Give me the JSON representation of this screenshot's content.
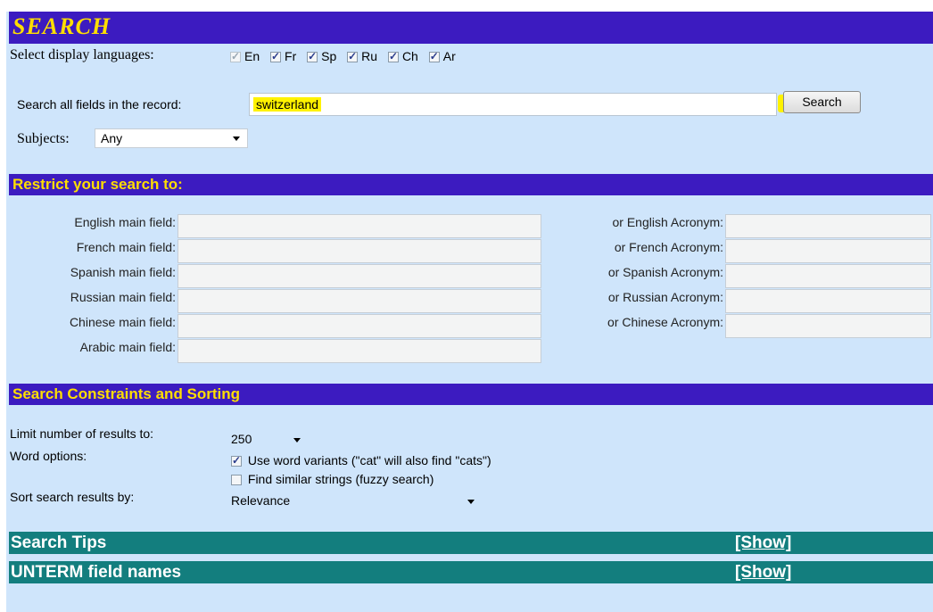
{
  "header": {
    "title": "SEARCH"
  },
  "languages": {
    "label": "Select display languages:",
    "items": [
      {
        "code": "En",
        "checked": true,
        "disabled": true
      },
      {
        "code": "Fr",
        "checked": true,
        "disabled": false
      },
      {
        "code": "Sp",
        "checked": true,
        "disabled": false
      },
      {
        "code": "Ru",
        "checked": true,
        "disabled": false
      },
      {
        "code": "Ch",
        "checked": true,
        "disabled": false
      },
      {
        "code": "Ar",
        "checked": true,
        "disabled": false
      }
    ]
  },
  "search": {
    "label": "Search all fields in the record:",
    "value": "switzerland",
    "button_label": "Search"
  },
  "subjects": {
    "label": "Subjects:",
    "selected": "Any"
  },
  "restrict": {
    "heading": "Restrict your search to:",
    "main_fields": [
      "English main field:",
      "French main field:",
      "Spanish main field:",
      "Russian main field:",
      "Chinese main field:",
      "Arabic main field:"
    ],
    "acronym_fields": [
      "or English Acronym:",
      "or French Acronym:",
      "or Spanish Acronym:",
      "or Russian Acronym:",
      "or Chinese Acronym:"
    ]
  },
  "constraints": {
    "heading": "Search Constraints and Sorting",
    "limit_label": "Limit number of results to:",
    "limit_value": "250",
    "word_options_label": "Word options:",
    "variants_label": "Use word variants (\"cat\" will also find \"cats\")",
    "variants_checked": true,
    "fuzzy_label": "Find similar strings (fuzzy search)",
    "fuzzy_checked": false,
    "sort_label": "Sort search results by:",
    "sort_value": "Relevance"
  },
  "tips": {
    "label": "Search Tips",
    "toggle": "[Show]"
  },
  "field_names": {
    "label": "UNTERM field names",
    "toggle": "[Show]"
  },
  "colors": {
    "page_bg": "#cfe5fb",
    "purple_bar": "#3c1bc0",
    "teal_bar": "#137e7e",
    "heading_text": "#ffde00",
    "highlight": "#fff200"
  }
}
